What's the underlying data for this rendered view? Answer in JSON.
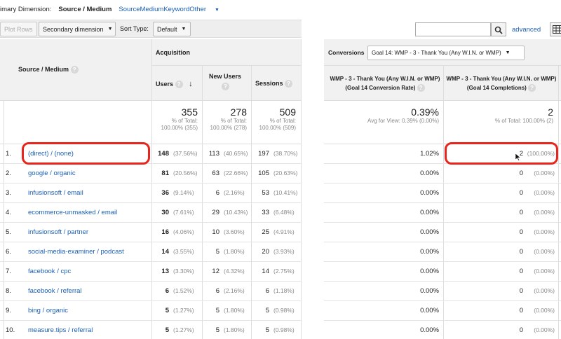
{
  "left": {
    "dimension_bar": {
      "label": "imary Dimension:",
      "selected": "Source / Medium",
      "options": [
        "Source",
        "Medium",
        "Keyword"
      ],
      "other": "Other"
    },
    "toolbar": {
      "plot_rows": "Plot Rows",
      "secondary_dimension": "Secondary dimension",
      "sort_type_label": "Sort Type:",
      "sort_type_value": "Default"
    },
    "headers": {
      "source_medium": "Source / Medium",
      "acquisition": "Acquisition",
      "users": "Users",
      "new_users": "New Users",
      "sessions": "Sessions"
    },
    "totals": {
      "users": "355",
      "users_sub": "% of Total: 100.00% (355)",
      "new_users": "278",
      "new_users_sub": "% of Total: 100.00% (278)",
      "sessions": "509",
      "sessions_sub": "% of Total: 100.00% (509)"
    },
    "rows": [
      {
        "n": "1.",
        "name": "(direct) / (none)",
        "users": "148",
        "users_pct": "(37.56%)",
        "new": "113",
        "new_pct": "(40.65%)",
        "sess": "197",
        "sess_pct": "(38.70%)"
      },
      {
        "n": "2.",
        "name": "google / organic",
        "users": "81",
        "users_pct": "(20.56%)",
        "new": "63",
        "new_pct": "(22.66%)",
        "sess": "105",
        "sess_pct": "(20.63%)"
      },
      {
        "n": "3.",
        "name": "infusionsoft / email",
        "users": "36",
        "users_pct": "(9.14%)",
        "new": "6",
        "new_pct": "(2.16%)",
        "sess": "53",
        "sess_pct": "(10.41%)"
      },
      {
        "n": "4.",
        "name": "ecommerce-unmasked / email",
        "users": "30",
        "users_pct": "(7.61%)",
        "new": "29",
        "new_pct": "(10.43%)",
        "sess": "33",
        "sess_pct": "(6.48%)"
      },
      {
        "n": "5.",
        "name": "infusionsoft / partner",
        "users": "16",
        "users_pct": "(4.06%)",
        "new": "10",
        "new_pct": "(3.60%)",
        "sess": "25",
        "sess_pct": "(4.91%)"
      },
      {
        "n": "6.",
        "name": "social-media-examiner / podcast",
        "users": "14",
        "users_pct": "(3.55%)",
        "new": "5",
        "new_pct": "(1.80%)",
        "sess": "20",
        "sess_pct": "(3.93%)"
      },
      {
        "n": "7.",
        "name": "facebook / cpc",
        "users": "13",
        "users_pct": "(3.30%)",
        "new": "12",
        "new_pct": "(4.32%)",
        "sess": "14",
        "sess_pct": "(2.75%)"
      },
      {
        "n": "8.",
        "name": "facebook / referral",
        "users": "6",
        "users_pct": "(1.52%)",
        "new": "6",
        "new_pct": "(2.16%)",
        "sess": "6",
        "sess_pct": "(1.18%)"
      },
      {
        "n": "9.",
        "name": "bing / organic",
        "users": "5",
        "users_pct": "(1.27%)",
        "new": "5",
        "new_pct": "(1.80%)",
        "sess": "5",
        "sess_pct": "(0.98%)"
      },
      {
        "n": "10.",
        "name": "measure.tips / referral",
        "users": "5",
        "users_pct": "(1.27%)",
        "new": "5",
        "new_pct": "(1.80%)",
        "sess": "5",
        "sess_pct": "(0.98%)"
      }
    ]
  },
  "right": {
    "search_placeholder": "",
    "advanced": "advanced",
    "conversions_label": "Conversions",
    "goal_select": "Goal 14: WMP - 3 - Thank You (Any W.I.N. or WMP)",
    "headers": {
      "rate": "WMP - 3 - Thank You (Any W.I.N. or WMP) (Goal 14 Conversion Rate)",
      "completions": "WMP - 3 - Thank You (Any W.I.N. or WMP) (Goal 14 Completions)"
    },
    "totals": {
      "rate": "0.39%",
      "rate_sub": "Avg for View: 0.39% (0.00%)",
      "completions": "2",
      "completions_sub": "% of Total: 100.00% (2)"
    },
    "rows": [
      {
        "rate": "1.02%",
        "comp": "2",
        "comp_pct": "(100.00%)"
      },
      {
        "rate": "0.00%",
        "comp": "0",
        "comp_pct": "(0.00%)"
      },
      {
        "rate": "0.00%",
        "comp": "0",
        "comp_pct": "(0.00%)"
      },
      {
        "rate": "0.00%",
        "comp": "0",
        "comp_pct": "(0.00%)"
      },
      {
        "rate": "0.00%",
        "comp": "0",
        "comp_pct": "(0.00%)"
      },
      {
        "rate": "0.00%",
        "comp": "0",
        "comp_pct": "(0.00%)"
      },
      {
        "rate": "0.00%",
        "comp": "0",
        "comp_pct": "(0.00%)"
      },
      {
        "rate": "0.00%",
        "comp": "0",
        "comp_pct": "(0.00%)"
      },
      {
        "rate": "0.00%",
        "comp": "0",
        "comp_pct": "(0.00%)"
      },
      {
        "rate": "0.00%",
        "comp": "0",
        "comp_pct": "(0.00%)"
      }
    ]
  },
  "colors": {
    "highlight": "#e8251c",
    "link": "#1a5fb4",
    "header_bg": "#f1f1f1"
  },
  "icons": [
    "help-icon",
    "sort-down-arrow-icon",
    "search-icon",
    "grid-view-icon",
    "dropdown-caret-icon",
    "mouse-cursor-icon"
  ]
}
